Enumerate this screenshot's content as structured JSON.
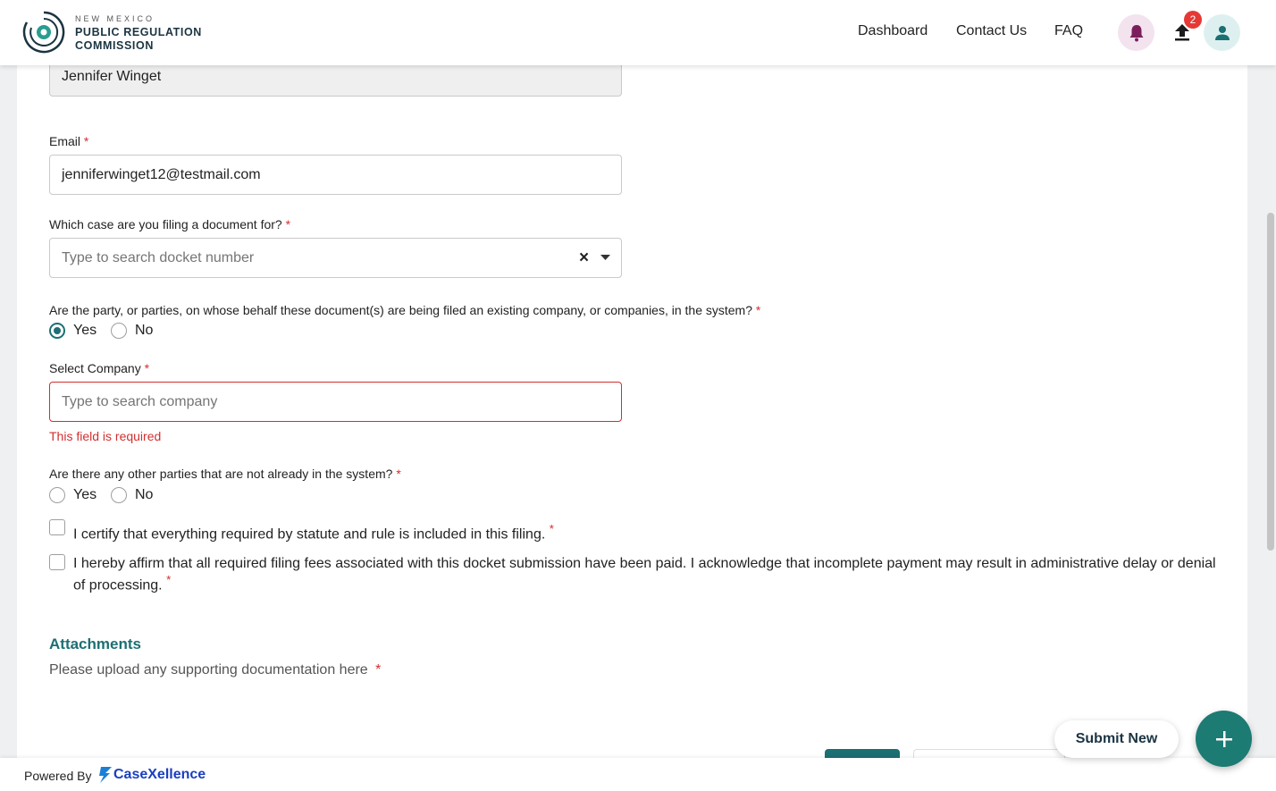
{
  "brand": {
    "small": "NEW MEXICO",
    "line1": "PUBLIC REGULATION",
    "line2": "COMMISSION"
  },
  "nav": {
    "dashboard": "Dashboard",
    "contact": "Contact Us",
    "faq": "FAQ"
  },
  "notifications": {
    "upload_badge": "2"
  },
  "form": {
    "name_value": "Jennifer Winget",
    "email_label": "Email",
    "email_value": "jenniferwinget12@testmail.com",
    "case_label": "Which case are you filing a document for?",
    "case_placeholder": "Type to search docket number",
    "clear_symbol": "×",
    "party_question": "Are the party, or parties, on whose behalf these document(s) are being filed an existing company, or companies, in the system?",
    "party_options": [
      "Yes",
      "No"
    ],
    "party_selected": "Yes",
    "company_label": "Select Company",
    "company_placeholder": "Type to search company",
    "company_error": "This field is required",
    "other_parties_question": "Are there any other parties that are not already in the system?",
    "other_parties_options": [
      "Yes",
      "No"
    ],
    "certify_text": "I certify that everything required by statute and rule is included in this filing.",
    "affirm_text": "I hereby affirm that all required filing fees associated with this docket submission have been paid. I acknowledge that incomplete payment may result in administrative delay or denial of processing.",
    "required_mark": "*"
  },
  "attachments": {
    "title": "Attachments",
    "subtitle": "Please upload any supporting documentation here"
  },
  "footer": {
    "powered_by": "Powered By",
    "brand_name": "CaseXellence"
  },
  "actions": {
    "submit_new": "Submit New"
  },
  "colors": {
    "accent": "#1c6f72",
    "error": "#d32f2f",
    "badge": "#e53935",
    "bell_bg": "#f3e3ef",
    "bell_icon": "#7b1f5c",
    "footer_brand": "#1a3fbf"
  }
}
